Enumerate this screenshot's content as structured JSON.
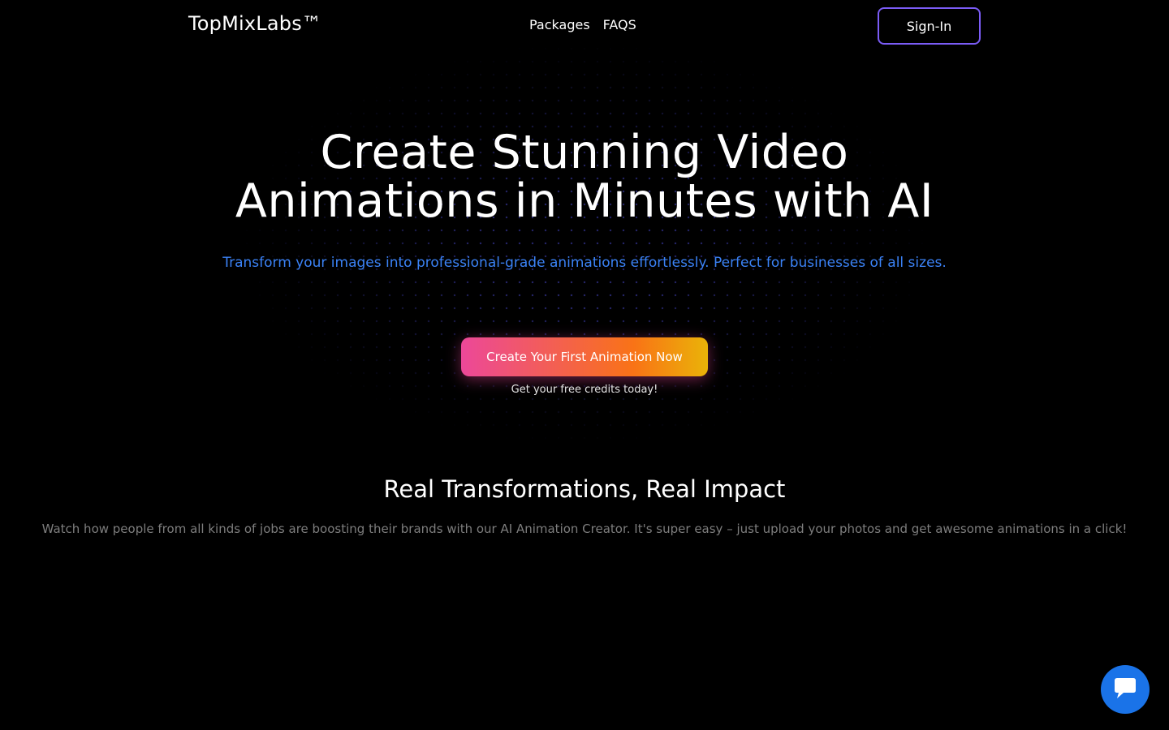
{
  "header": {
    "logo": "TopMixLabs™",
    "nav": [
      {
        "label": "Packages"
      },
      {
        "label": "FAQS"
      }
    ],
    "signin_label": "Sign-In"
  },
  "hero": {
    "title_line1": "Create Stunning Video",
    "title_line2": "Animations in Minutes with AI",
    "subtitle": "Transform your images into professional-grade animations effortlessly. Perfect for businesses of all sizes.",
    "cta_label": "Create Your First Animation Now",
    "cta_note": "Get your free credits today!"
  },
  "section": {
    "title": "Real Transformations, Real Impact",
    "description": "Watch how people from all kinds of jobs are boosting their brands with our AI Animation Creator. It's super easy – just upload your photos and get awesome animations in a click!"
  },
  "chat": {
    "icon": "chat-bubble-icon"
  },
  "colors": {
    "background": "#000000",
    "accent_purple": "#7b5cf6",
    "subtitle_blue": "#3b82f6",
    "cta_gradient_start": "#ec4899",
    "cta_gradient_end": "#eab308",
    "chat_blue": "#1a73e8"
  }
}
